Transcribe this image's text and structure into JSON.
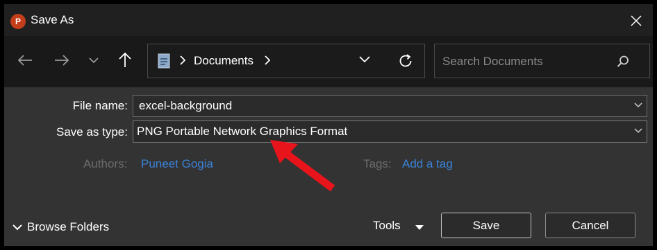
{
  "window": {
    "title": "Save As",
    "app_icon_letter": "P",
    "app_icon_color": "#c43e1c"
  },
  "nav": {
    "back": "back-arrow-icon",
    "forward": "forward-arrow-icon",
    "recent": "chevron-down-icon",
    "up": "up-arrow-icon"
  },
  "address": {
    "location": "Documents"
  },
  "search": {
    "placeholder": "Search Documents"
  },
  "form": {
    "file_name_label": "File name:",
    "file_name_value": "excel-background",
    "save_type_label": "Save as type:",
    "save_type_value": "PNG Portable Network Graphics Format",
    "authors_label": "Authors:",
    "authors_value": "Puneet Gogia",
    "tags_label": "Tags:",
    "tags_value": "Add a tag"
  },
  "footer": {
    "browse_folders": "Browse Folders",
    "tools": "Tools",
    "save": "Save",
    "cancel": "Cancel"
  },
  "colors": {
    "link": "#3b82d8",
    "annotation_arrow": "#e8141b"
  }
}
